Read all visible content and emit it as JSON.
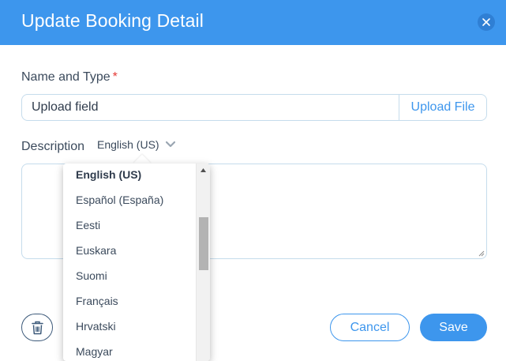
{
  "dialog": {
    "title": "Update Booking Detail",
    "close_icon": "close-icon"
  },
  "name_and_type": {
    "label": "Name and Type",
    "required_mark": "*",
    "input_value": "Upload field",
    "upload_button_label": "Upload File"
  },
  "description": {
    "label": "Description",
    "language_selected": "English (US)",
    "value": ""
  },
  "language_dropdown": {
    "items": [
      "English (US)",
      "Español (España)",
      "Eesti",
      "Euskara",
      "Suomi",
      "Français",
      "Hrvatski",
      "Magyar"
    ],
    "selected_index": 0
  },
  "footer": {
    "delete_icon": "trash-icon",
    "cancel_label": "Cancel",
    "save_label": "Save"
  },
  "colors": {
    "header_bg": "#3d96ed",
    "accent": "#3d96ed",
    "required": "#e53935"
  }
}
